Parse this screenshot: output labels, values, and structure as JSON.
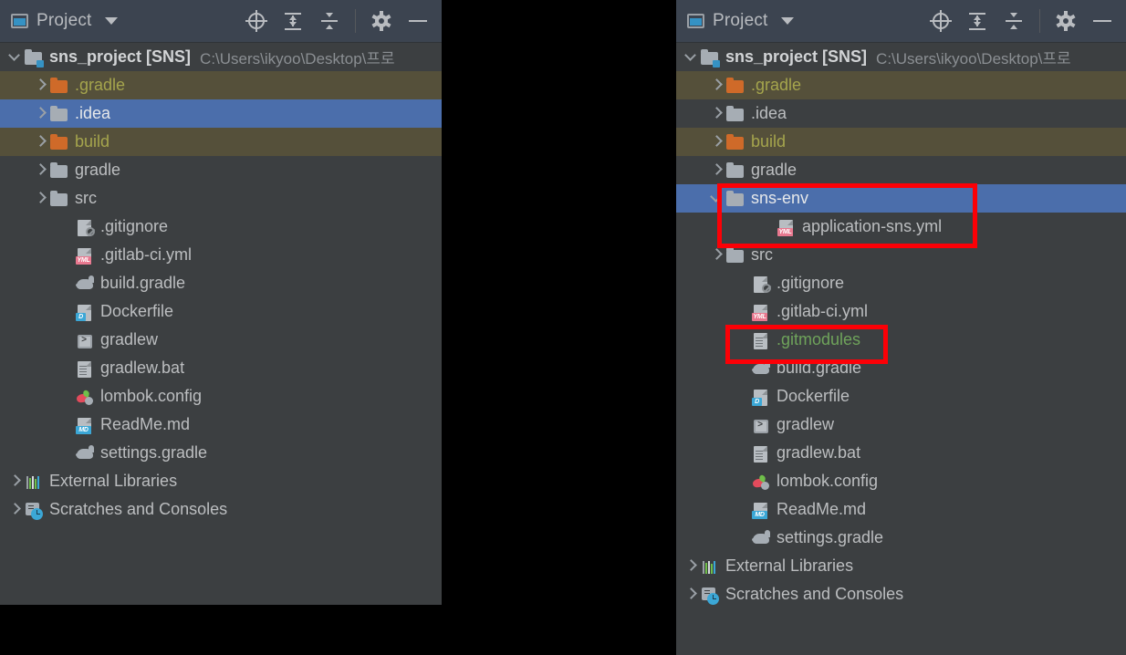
{
  "window": {
    "background": "#000000",
    "panel_bg": "#3c3f41",
    "header_bg": "#3c4450",
    "selection_color": "#4b6eab",
    "ignored_row_color": "#55503a",
    "annotation_color": "#fc0006"
  },
  "header": {
    "title": "Project",
    "icons": {
      "project_icon": "project-window-icon",
      "dropdown": "chevron-down-icon",
      "locate": "locate-target-icon",
      "expand_all": "expand-all-icon",
      "collapse_all": "collapse-all-icon",
      "settings": "gear-icon",
      "hide": "minimize-icon"
    }
  },
  "left_panel": {
    "root": {
      "name": "sns_project [SNS]",
      "path": "C:\\Users\\ikyoo\\Desktop\\프로",
      "expanded": true
    },
    "rows": [
      {
        "label": ".gradle",
        "icon": "folder-orange-icon",
        "indent": 1,
        "arrow": "right",
        "state": "ignored",
        "color": "olive"
      },
      {
        "label": ".idea",
        "icon": "folder-icon",
        "indent": 1,
        "arrow": "right",
        "state": "selected",
        "color": "white"
      },
      {
        "label": "build",
        "icon": "folder-orange-icon",
        "indent": 1,
        "arrow": "right",
        "state": "ignored",
        "color": "olive"
      },
      {
        "label": "gradle",
        "icon": "folder-icon",
        "indent": 1,
        "arrow": "right",
        "state": "none",
        "color": "normal"
      },
      {
        "label": "src",
        "icon": "folder-icon",
        "indent": 1,
        "arrow": "right",
        "state": "none",
        "color": "normal"
      },
      {
        "label": ".gitignore",
        "icon": "gitignore-file-icon",
        "indent": 2,
        "arrow": "none",
        "state": "none",
        "color": "normal"
      },
      {
        "label": ".gitlab-ci.yml",
        "icon": "yaml-file-icon",
        "indent": 2,
        "arrow": "none",
        "state": "none",
        "color": "normal"
      },
      {
        "label": "build.gradle",
        "icon": "gradle-file-icon",
        "indent": 2,
        "arrow": "none",
        "state": "none",
        "color": "normal"
      },
      {
        "label": "Dockerfile",
        "icon": "docker-file-icon",
        "indent": 2,
        "arrow": "none",
        "state": "none",
        "color": "normal"
      },
      {
        "label": "gradlew",
        "icon": "shell-script-icon",
        "indent": 2,
        "arrow": "none",
        "state": "none",
        "color": "normal"
      },
      {
        "label": "gradlew.bat",
        "icon": "text-file-icon",
        "indent": 2,
        "arrow": "none",
        "state": "none",
        "color": "normal"
      },
      {
        "label": "lombok.config",
        "icon": "lombok-file-icon",
        "indent": 2,
        "arrow": "none",
        "state": "none",
        "color": "normal"
      },
      {
        "label": "ReadMe.md",
        "icon": "markdown-file-icon",
        "indent": 2,
        "arrow": "none",
        "state": "none",
        "color": "normal"
      },
      {
        "label": "settings.gradle",
        "icon": "gradle-file-icon",
        "indent": 2,
        "arrow": "none",
        "state": "none",
        "color": "normal"
      },
      {
        "label": "External Libraries",
        "icon": "external-libraries-icon",
        "indent": 0,
        "arrow": "right",
        "state": "none",
        "color": "normal"
      },
      {
        "label": "Scratches and Consoles",
        "icon": "scratches-icon",
        "indent": 0,
        "arrow": "right",
        "state": "none",
        "color": "normal"
      }
    ]
  },
  "right_panel": {
    "root": {
      "name": "sns_project [SNS]",
      "path": "C:\\Users\\ikyoo\\Desktop\\프로",
      "expanded": true
    },
    "rows": [
      {
        "label": ".gradle",
        "icon": "folder-orange-icon",
        "indent": 1,
        "arrow": "right",
        "state": "ignored",
        "color": "olive"
      },
      {
        "label": ".idea",
        "icon": "folder-icon",
        "indent": 1,
        "arrow": "right",
        "state": "none",
        "color": "normal"
      },
      {
        "label": "build",
        "icon": "folder-orange-icon",
        "indent": 1,
        "arrow": "right",
        "state": "ignored",
        "color": "olive"
      },
      {
        "label": "gradle",
        "icon": "folder-icon",
        "indent": 1,
        "arrow": "right",
        "state": "none",
        "color": "normal"
      },
      {
        "label": "sns-env",
        "icon": "folder-icon",
        "indent": 1,
        "arrow": "down",
        "state": "selected",
        "color": "white"
      },
      {
        "label": "application-sns.yml",
        "icon": "yaml-file-icon",
        "indent": 3,
        "arrow": "none",
        "state": "none",
        "color": "normal"
      },
      {
        "label": "src",
        "icon": "folder-icon",
        "indent": 1,
        "arrow": "right",
        "state": "none",
        "color": "normal"
      },
      {
        "label": ".gitignore",
        "icon": "gitignore-file-icon",
        "indent": 2,
        "arrow": "none",
        "state": "none",
        "color": "normal"
      },
      {
        "label": ".gitlab-ci.yml",
        "icon": "yaml-file-icon",
        "indent": 2,
        "arrow": "none",
        "state": "none",
        "color": "normal"
      },
      {
        "label": ".gitmodules",
        "icon": "text-file-icon",
        "indent": 2,
        "arrow": "none",
        "state": "none",
        "color": "green"
      },
      {
        "label": "build.gradle",
        "icon": "gradle-file-icon",
        "indent": 2,
        "arrow": "none",
        "state": "none",
        "color": "normal"
      },
      {
        "label": "Dockerfile",
        "icon": "docker-file-icon",
        "indent": 2,
        "arrow": "none",
        "state": "none",
        "color": "normal"
      },
      {
        "label": "gradlew",
        "icon": "shell-script-icon",
        "indent": 2,
        "arrow": "none",
        "state": "none",
        "color": "normal"
      },
      {
        "label": "gradlew.bat",
        "icon": "text-file-icon",
        "indent": 2,
        "arrow": "none",
        "state": "none",
        "color": "normal"
      },
      {
        "label": "lombok.config",
        "icon": "lombok-file-icon",
        "indent": 2,
        "arrow": "none",
        "state": "none",
        "color": "normal"
      },
      {
        "label": "ReadMe.md",
        "icon": "markdown-file-icon",
        "indent": 2,
        "arrow": "none",
        "state": "none",
        "color": "normal"
      },
      {
        "label": "settings.gradle",
        "icon": "gradle-file-icon",
        "indent": 2,
        "arrow": "none",
        "state": "none",
        "color": "normal"
      },
      {
        "label": "External Libraries",
        "icon": "external-libraries-icon",
        "indent": 0,
        "arrow": "right",
        "state": "none",
        "color": "normal"
      },
      {
        "label": "Scratches and Consoles",
        "icon": "scratches-icon",
        "indent": 0,
        "arrow": "right",
        "state": "none",
        "color": "normal"
      }
    ],
    "annotations": [
      {
        "name": "sns-env-highlight",
        "target": "sns-env / application-sns.yml"
      },
      {
        "name": "gitmodules-highlight",
        "target": ".gitmodules"
      }
    ]
  }
}
